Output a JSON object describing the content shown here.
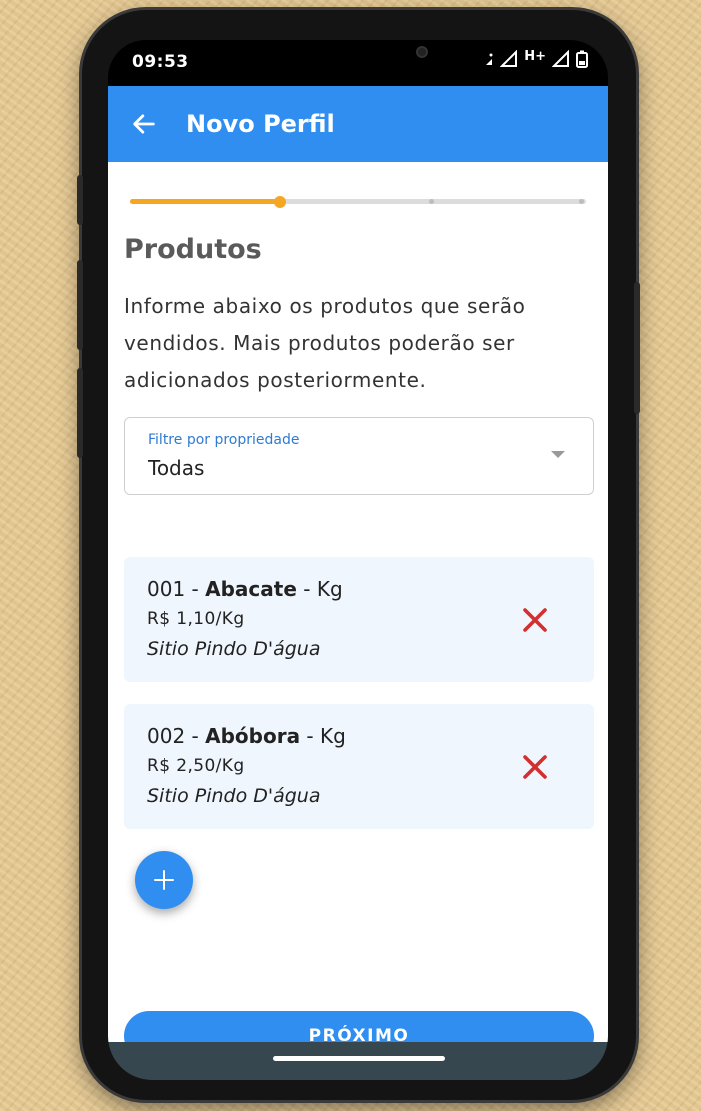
{
  "status_bar": {
    "time": "09:53",
    "network": "H+"
  },
  "app_bar": {
    "title": "Novo Perfil",
    "back_icon": "arrow-left-icon",
    "color": "#2f8ef0"
  },
  "stepper": {
    "progress": 0.33,
    "active_color": "#f5a623",
    "track_color": "#dcdcdc"
  },
  "section": {
    "title": "Produtos",
    "description": "Informe abaixo os produtos que serão vendidos. Mais produtos poderão ser adicionados posteriormente."
  },
  "filter": {
    "label": "Filtre por propriedade",
    "value": "Todas",
    "icon": "chevron-down-icon"
  },
  "products": [
    {
      "code": "001",
      "name": "Abacate",
      "unit": "Kg",
      "price": "R$ 1,10/Kg",
      "origin": "Sitio Pindo D'água"
    },
    {
      "code": "002",
      "name": "Abóbora",
      "unit": "Kg",
      "price": "R$ 2,50/Kg",
      "origin": "Sitio Pindo D'água"
    }
  ],
  "fab": {
    "icon": "plus-icon"
  },
  "next_button": {
    "label": "PRÓXIMO"
  },
  "colors": {
    "primary": "#2f8ef0",
    "accent": "#f5a623",
    "danger": "#d32f2f",
    "card_bg": "#f0f6fd"
  }
}
